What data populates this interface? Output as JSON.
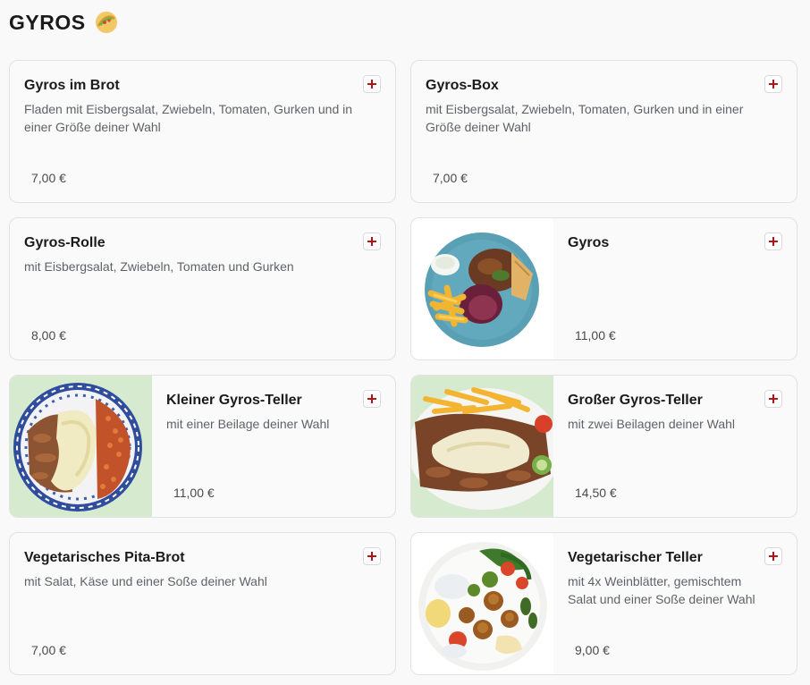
{
  "section": {
    "title": "GYROS",
    "icon": "taco-icon"
  },
  "colors": {
    "accent": "#b3141b",
    "card_border": "#e2e2e4",
    "text_muted": "#5f6368",
    "image_bg_green": "#d6ead0"
  },
  "items": [
    {
      "title": "Gyros im Brot",
      "description": "Fladen mit Eisbergsalat, Zwiebeln, Tomaten, Gurken und in einer Größe deiner Wahl",
      "price": "7,00 €",
      "image": null
    },
    {
      "title": "Gyros-Box",
      "description": "mit Eisbergsalat, Zwiebeln, Tomaten, Gurken und in einer Größe deiner Wahl",
      "price": "7,00 €",
      "image": null
    },
    {
      "title": "Gyros-Rolle",
      "description": "mit Eisbergsalat, Zwiebeln, Tomaten und Gurken",
      "price": "8,00 €",
      "image": null
    },
    {
      "title": "Gyros",
      "description": "",
      "price": "11,00 €",
      "image": "gyros-plate-photo"
    },
    {
      "title": "Kleiner Gyros-Teller",
      "description": "mit einer Beilage deiner Wahl",
      "price": "11,00 €",
      "image": "small-gyros-plate-photo"
    },
    {
      "title": "Großer Gyros-Teller",
      "description": "mit zwei Beilagen deiner Wahl",
      "price": "14,50 €",
      "image": "large-gyros-plate-photo"
    },
    {
      "title": "Vegetarisches Pita-Brot",
      "description": "mit Salat, Käse und einer Soße deiner Wahl",
      "price": "7,00 €",
      "image": null
    },
    {
      "title": "Vegetarischer Teller",
      "description": "mit 4x Weinblätter, gemischtem Salat und einer Soße deiner Wahl",
      "price": "9,00 €",
      "image": "vegetarian-plate-photo"
    }
  ]
}
